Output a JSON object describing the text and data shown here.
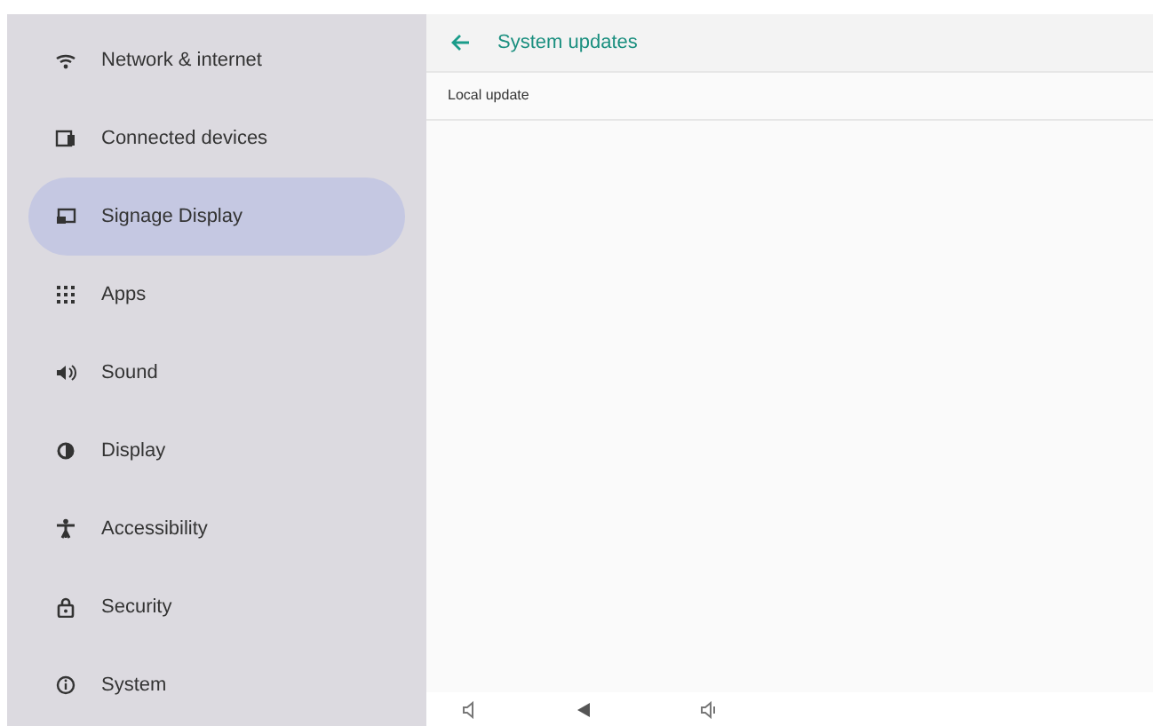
{
  "sidebar": {
    "items": [
      {
        "label": "Network & internet",
        "selected": false
      },
      {
        "label": "Connected devices",
        "selected": false
      },
      {
        "label": "Signage Display",
        "selected": true
      },
      {
        "label": "Apps",
        "selected": false
      },
      {
        "label": "Sound",
        "selected": false
      },
      {
        "label": "Display",
        "selected": false
      },
      {
        "label": "Accessibility",
        "selected": false
      },
      {
        "label": "Security",
        "selected": false
      },
      {
        "label": "System",
        "selected": false
      }
    ]
  },
  "header": {
    "title": "System updates"
  },
  "list": [
    {
      "label": "Local update"
    }
  ]
}
